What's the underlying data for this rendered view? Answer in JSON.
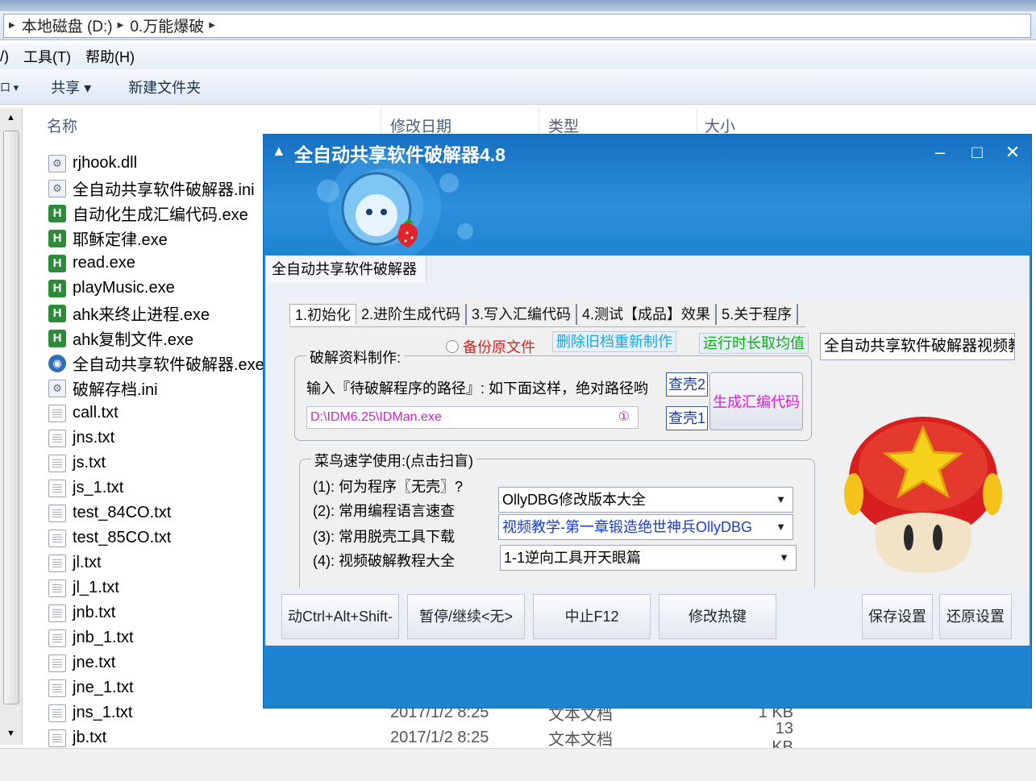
{
  "explorer": {
    "breadcrumb": [
      "本地磁盘 (D:)",
      "0.万能爆破"
    ],
    "menu": [
      "/)",
      "工具(T)",
      "帮助(H)"
    ],
    "toolbar": [
      "共享 ▾",
      "新建文件夹"
    ],
    "columns": {
      "name": "名称",
      "date": "修改日期",
      "type": "类型",
      "size": "大小"
    },
    "files": [
      {
        "name": "rjhook.dll",
        "icon": "dll-file-icon",
        "date": "",
        "type": "",
        "size": ""
      },
      {
        "name": "全自动共享软件破解器.ini",
        "icon": "ini-file-icon",
        "date": "",
        "type": "",
        "size": ""
      },
      {
        "name": "自动化生成汇编代码.exe",
        "icon": "ahk-exe-icon",
        "date": "",
        "type": "",
        "size": ""
      },
      {
        "name": "耶稣定律.exe",
        "icon": "ahk-exe-icon",
        "date": "",
        "type": "",
        "size": ""
      },
      {
        "name": "read.exe",
        "icon": "ahk-exe-icon",
        "date": "",
        "type": "",
        "size": ""
      },
      {
        "name": "playMusic.exe",
        "icon": "ahk-exe-icon",
        "date": "",
        "type": "",
        "size": ""
      },
      {
        "name": "ahk来终止进程.exe",
        "icon": "ahk-exe-icon",
        "date": "",
        "type": "",
        "size": ""
      },
      {
        "name": "ahk复制文件.exe",
        "icon": "ahk-exe-icon",
        "date": "",
        "type": "",
        "size": ""
      },
      {
        "name": "全自动共享软件破解器.exe",
        "icon": "app-exe-icon",
        "date": "",
        "type": "",
        "size": ""
      },
      {
        "name": "破解存档.ini",
        "icon": "ini-file-icon",
        "date": "",
        "type": "",
        "size": ""
      },
      {
        "name": "call.txt",
        "icon": "txt-file-icon",
        "date": "",
        "type": "",
        "size": ""
      },
      {
        "name": "jns.txt",
        "icon": "txt-file-icon",
        "date": "",
        "type": "",
        "size": ""
      },
      {
        "name": "js.txt",
        "icon": "txt-file-icon",
        "date": "",
        "type": "",
        "size": ""
      },
      {
        "name": "js_1.txt",
        "icon": "txt-file-icon",
        "date": "",
        "type": "",
        "size": ""
      },
      {
        "name": "test_84CO.txt",
        "icon": "txt-file-icon",
        "date": "",
        "type": "",
        "size": ""
      },
      {
        "name": "test_85CO.txt",
        "icon": "txt-file-icon",
        "date": "",
        "type": "",
        "size": ""
      },
      {
        "name": "jl.txt",
        "icon": "txt-file-icon",
        "date": "",
        "type": "",
        "size": ""
      },
      {
        "name": "jl_1.txt",
        "icon": "txt-file-icon",
        "date": "",
        "type": "",
        "size": ""
      },
      {
        "name": "jnb.txt",
        "icon": "txt-file-icon",
        "date": "",
        "type": "",
        "size": ""
      },
      {
        "name": "jnb_1.txt",
        "icon": "txt-file-icon",
        "date": "",
        "type": "",
        "size": ""
      },
      {
        "name": "jne.txt",
        "icon": "txt-file-icon",
        "date": "",
        "type": "",
        "size": ""
      },
      {
        "name": "jne_1.txt",
        "icon": "txt-file-icon",
        "date": "",
        "type": "",
        "size": ""
      },
      {
        "name": "jns_1.txt",
        "icon": "txt-file-icon",
        "date": "2017/1/2 8:25",
        "type": "文本文档",
        "size": "1 KB"
      },
      {
        "name": "jb.txt",
        "icon": "txt-file-icon",
        "date": "2017/1/2 8:25",
        "type": "文本文档",
        "size": "13 KB"
      }
    ]
  },
  "app": {
    "title": "全自动共享软件破解器4.8",
    "panel_tab": "全自动共享软件破解器",
    "tabs": [
      "1.初始化",
      "2.进阶生成代码",
      "3.写入汇编代码",
      "4.测试【成品】效果",
      "5.关于程序"
    ],
    "backup_label": "备份原文件",
    "delete_btn": "删除旧档重新制作",
    "runtime_btn": "运行时长取均值",
    "video_field": "全自动共享软件破解器视频教",
    "crack_group": {
      "legend": "破解资料制作:",
      "hint": "输入『待破解程序的路径』: 如下面这样，绝对路径哟",
      "path_value": "D:\\IDM6.25\\IDMan.exe",
      "path_marker": "①",
      "find2": "查壳2",
      "find1": "查壳1",
      "generate": "生成汇编代码"
    },
    "quick_group": {
      "legend": "菜鸟速学使用:(点击扫盲)",
      "rows": [
        {
          "label": "(1): 何为程序〖无壳〗?",
          "select": "OllyDBG修改版本大全",
          "color": "#111111"
        },
        {
          "label": "(2): 常用编程语言速查",
          "select": "视频教学-第一章锻造绝世神兵OllyDBG",
          "color": "#1a3ccf"
        },
        {
          "label": "(3): 常用脱壳工具下载",
          "select": "1-1逆向工具开天眼篇",
          "color": "#111111"
        },
        {
          "label": "(4): 视频破解教程大全",
          "select": "",
          "color": "#111111"
        }
      ]
    },
    "bottom_buttons": [
      "动Ctrl+Alt+Shift-",
      "暂停/继续<无>",
      "中止F12",
      "修改热键",
      "保存设置",
      "还原设置"
    ],
    "colors": {
      "window_blue": "#1d84d2",
      "red_text": "#e0201f",
      "cyan_text": "#1aa9e0",
      "green_text": "#10b010",
      "magenta_text": "#d21fd2"
    }
  }
}
